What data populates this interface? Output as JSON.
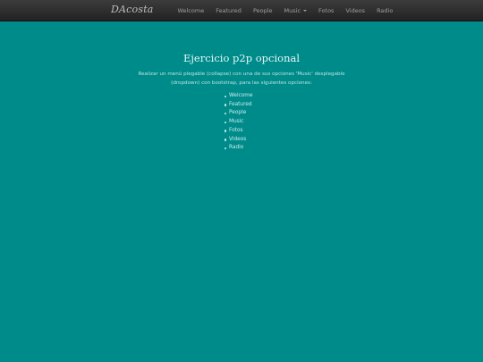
{
  "navbar": {
    "brand": "DAcosta",
    "items": [
      {
        "label": "Welcome"
      },
      {
        "label": "Featured"
      },
      {
        "label": "People"
      },
      {
        "label": "Music",
        "dropdown": true
      },
      {
        "label": "Fotos"
      },
      {
        "label": "Videos"
      },
      {
        "label": "Radio"
      }
    ]
  },
  "main": {
    "title": "Ejercicio p2p opcional",
    "description_line1": "Realizar un menú plegable (collapse) con una de sus opciones 'Music' desplegable",
    "description_line2": "(dropdown) con bootstrap, para las siguientes opciones:",
    "list": [
      "Welcome",
      "Featured",
      "People",
      "Music",
      "Fotos",
      "Videos",
      "Radio"
    ]
  },
  "colors": {
    "page_background": "#008b8b",
    "navbar_background": "#2a2a2a",
    "nav_text": "#9d9d9d"
  }
}
